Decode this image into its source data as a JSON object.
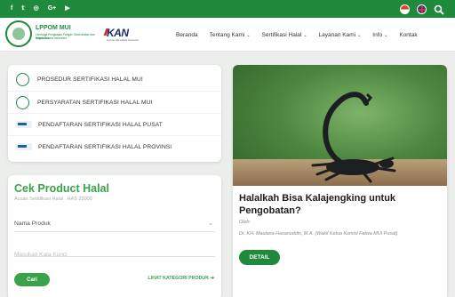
{
  "topbar": {
    "social_icons": [
      "facebook-icon",
      "twitter-icon",
      "instagram-icon",
      "google-plus-icon",
      "youtube-icon"
    ],
    "social_glyphs": [
      "f",
      "𝕥",
      "◎",
      "G+",
      "▶"
    ],
    "accent": "#1f8a3c"
  },
  "brand": {
    "name": "LPPOM MUI",
    "subtitle_line1": "Lembaga Pengkajian Pangan Obat-obatan dan Kosmetika",
    "subtitle_line2": "Majelis Ulama Indonesia",
    "partner": "KAN",
    "partner_sub": "Komite Akreditasi Nasional"
  },
  "nav": {
    "items": [
      {
        "label": "Beranda",
        "has_dropdown": false
      },
      {
        "label": "Tentang Kami",
        "has_dropdown": true
      },
      {
        "label": "Sertifikasi Halal",
        "has_dropdown": true
      },
      {
        "label": "Layanan Kami",
        "has_dropdown": true
      },
      {
        "label": "Info",
        "has_dropdown": true
      },
      {
        "label": "Kontak",
        "has_dropdown": false
      }
    ]
  },
  "quick_links": [
    {
      "label": "PROSEDUR SERTIFIKASI HALAL MUI"
    },
    {
      "label": "PERSYARATAN SERTIFIKASI HALAL MUI"
    },
    {
      "label": "PENDAFTARAN SERTIFIKASI HALAL PUSAT"
    },
    {
      "label": "PENDAFTARAN SERTIFIKASI HALAL PROVINSI"
    }
  ],
  "cek_product": {
    "title": "Cek Product Halal",
    "subtitle": "Acuan Sertifikasi Halal : HAS 23000",
    "select_value": "Nama Produk",
    "input_placeholder": "Masukan Kata Kunci",
    "search_button": "Cari",
    "category_link": "LIHAT KATEGORI PRODUK ➔"
  },
  "news": {
    "title": "Halalkah Bisa Kalajengking untuk Pengobatan?",
    "author_label": "Oleh:",
    "author": "Dr. KH. Maulana Hasanuddin, M.A. (Wakil Ketua Komisi Fatwa MUI Pusat)",
    "button": "DETAIL"
  }
}
